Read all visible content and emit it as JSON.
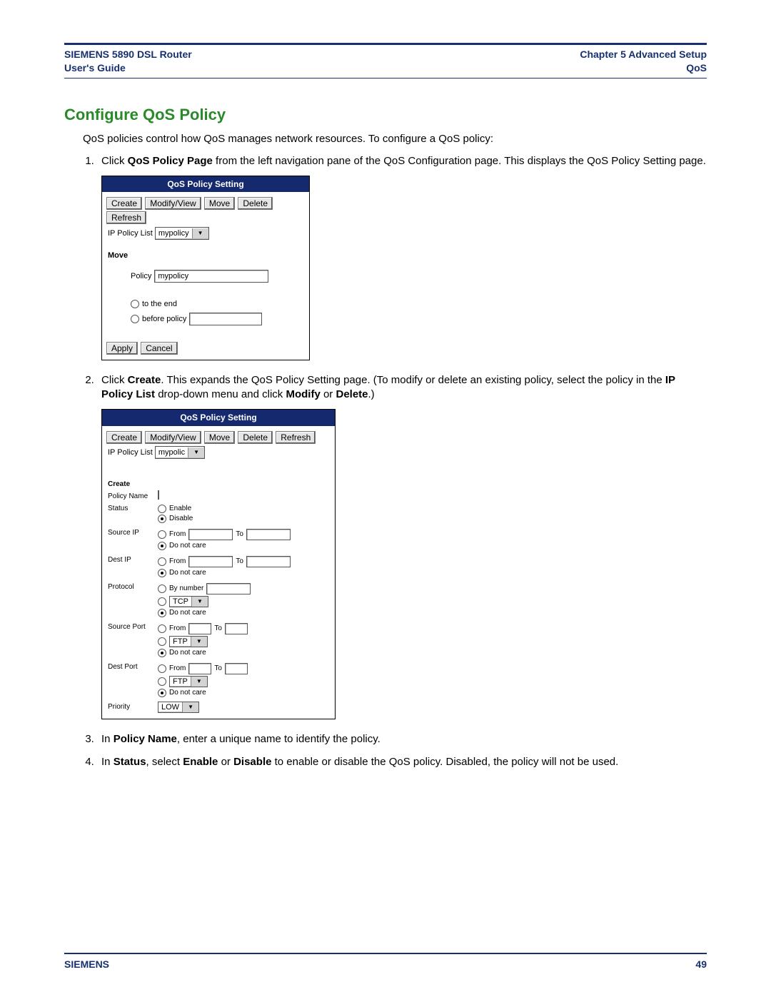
{
  "header": {
    "left_line1": "SIEMENS 5890 DSL Router",
    "left_line2": "User's Guide",
    "right_line1": "Chapter 5  Advanced Setup",
    "right_line2": "QoS"
  },
  "section_title": "Configure QoS Policy",
  "intro": "QoS policies control how QoS manages network resources. To configure a QoS policy:",
  "step1": {
    "pre": "Click ",
    "bold": "QoS Policy Page",
    "post": " from the left navigation pane of the QoS Configuration page. This displays the QoS Policy Setting page."
  },
  "panel_shared": {
    "title": "QoS Policy Setting",
    "btn_create": "Create",
    "btn_modify": "Modify/View",
    "btn_move": "Move",
    "btn_delete": "Delete",
    "btn_refresh": "Refresh",
    "ip_list_lbl": "IP Policy List",
    "btn_apply": "Apply",
    "btn_cancel": "Cancel"
  },
  "panel1": {
    "ip_sel": "mypolicy",
    "move": "Move",
    "policy_lbl": "Policy",
    "policy_val": "mypolicy",
    "radio_end": "to the end",
    "radio_before": "before policy"
  },
  "step2": {
    "t1": "Click ",
    "b1": "Create",
    "t2": ". This expands the QoS Policy Setting page. (To modify or delete an existing policy, select the policy in the ",
    "b2": "IP Policy List",
    "t3": " drop-down menu and click ",
    "b3": "Modify",
    "t4": " or ",
    "b4": "Delete",
    "t5": ".)"
  },
  "panel2": {
    "ip_sel": "mypolic",
    "create": "Create",
    "policy_name": "Policy Name",
    "status": "Status",
    "enable": "Enable",
    "disable": "Disable",
    "src_ip": "Source IP",
    "dest_ip": "Dest IP",
    "protocol": "Protocol",
    "src_port": "Source Port",
    "dest_port": "Dest Port",
    "priority": "Priority",
    "from": "From",
    "to": "To",
    "dnc": "Do not care",
    "by_number": "By number",
    "tcp": "TCP",
    "ftp": "FTP",
    "low": "LOW"
  },
  "step3": {
    "t1": "In ",
    "b1": "Policy Name",
    "t2": ", enter a unique name to identify the policy."
  },
  "step4": {
    "t1": "In ",
    "b1": "Status",
    "t2": ", select ",
    "b2": "Enable",
    "t3": " or ",
    "b3": "Disable",
    "t4": " to enable or disable the QoS policy. Disabled, the policy will not be used."
  },
  "footer": {
    "brand": "SIEMENS",
    "page": "49"
  }
}
